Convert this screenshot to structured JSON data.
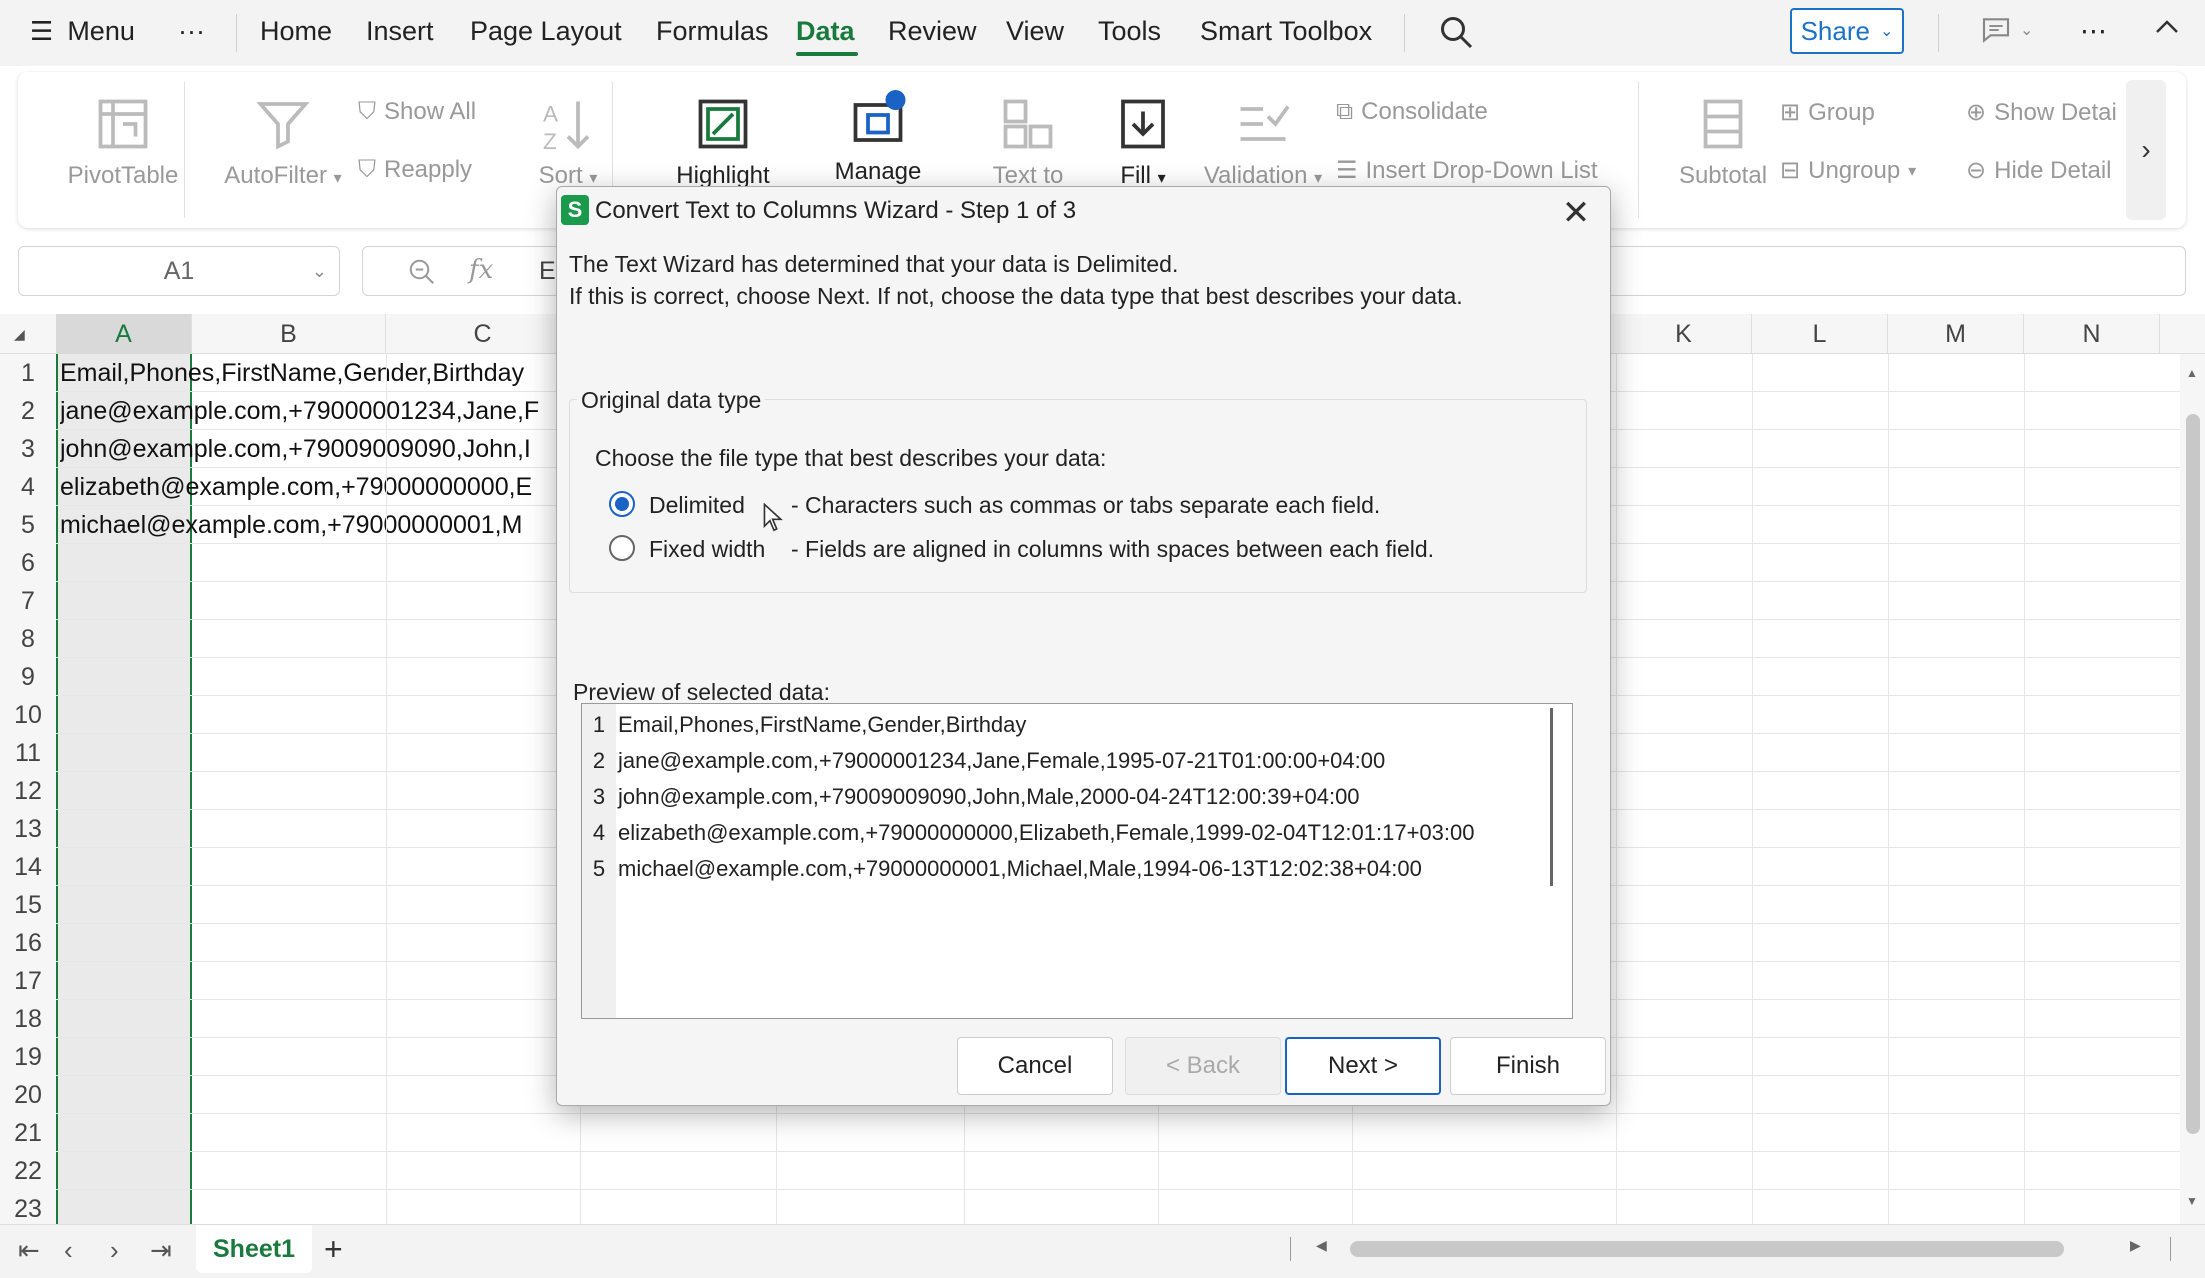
{
  "menubar": {
    "menu_label": "Menu",
    "more_label": "···",
    "tabs": [
      "Home",
      "Insert",
      "Page Layout",
      "Formulas",
      "Data",
      "Review",
      "View",
      "Tools",
      "Smart Toolbox"
    ],
    "active_tab": "Data",
    "share_label": "Share"
  },
  "ribbon": {
    "pivottable": "PivotTable",
    "autofilter": "AutoFilter",
    "show_all": "Show All",
    "reapply": "Reapply",
    "sort": "Sort",
    "highlight": "Highlight",
    "manage": "Manage",
    "text_to": "Text to",
    "fill": "Fill",
    "validation": "Validation",
    "consolidate": "Consolidate",
    "insert_dropdown": "Insert Drop-Down List",
    "subtotal": "Subtotal",
    "group": "Group",
    "ungroup": "Ungroup",
    "show_detail": "Show Detai",
    "hide_detail": "Hide Detail"
  },
  "formula": {
    "cell_ref": "A1",
    "fx": "fx",
    "content_peek": "E"
  },
  "grid": {
    "columns_left": [
      "A",
      "B",
      "C"
    ],
    "columns_right": [
      "K",
      "L",
      "M",
      "N"
    ],
    "rows": [
      "1",
      "2",
      "3",
      "4",
      "5",
      "6",
      "7",
      "8",
      "9",
      "10",
      "11",
      "12",
      "13",
      "14",
      "15",
      "16",
      "17",
      "18",
      "19",
      "20",
      "21",
      "22",
      "23"
    ],
    "cells": [
      "Email,Phones,FirstName,Gender,Birthday",
      "jane@example.com,+79000001234,Jane,F",
      "john@example.com,+79009009090,John,I",
      "elizabeth@example.com,+79000000000,E",
      "michael@example.com,+79000000001,M"
    ]
  },
  "sheet": {
    "tab_label": "Sheet1",
    "add_label": "+"
  },
  "dialog": {
    "title": "Convert Text to Columns Wizard - Step 1 of 3",
    "intro_line1": "The Text Wizard has determined that your data is Delimited.",
    "intro_line2": "If this is correct, choose Next. If not, choose the data type that best describes your data.",
    "group_label": "Original data type",
    "choose_label": "Choose the file type that best describes your data:",
    "options": [
      {
        "label": "Delimited",
        "desc": "- Characters such as commas or tabs separate each field.",
        "checked": true
      },
      {
        "label": "Fixed width",
        "desc": "- Fields are aligned in columns with spaces between each field.",
        "checked": false
      }
    ],
    "preview_label": "Preview of selected data:",
    "preview_lines": [
      {
        "n": "1",
        "text": "Email,Phones,FirstName,Gender,Birthday"
      },
      {
        "n": "2",
        "text": "jane@example.com,+79000001234,Jane,Female,1995-07-21T01:00:00+04:00"
      },
      {
        "n": "3",
        "text": "john@example.com,+79009009090,John,Male,2000-04-24T12:00:39+04:00"
      },
      {
        "n": "4",
        "text": "elizabeth@example.com,+79000000000,Elizabeth,Female,1999-02-04T12:01:17+03:00"
      },
      {
        "n": "5",
        "text": "michael@example.com,+79000000001,Michael,Male,1994-06-13T12:02:38+04:00"
      }
    ],
    "buttons": {
      "cancel": "Cancel",
      "back": "< Back",
      "next": "Next >",
      "finish": "Finish"
    }
  },
  "colors": {
    "accent_green": "#1a7a3e",
    "accent_blue": "#1a62c4"
  }
}
